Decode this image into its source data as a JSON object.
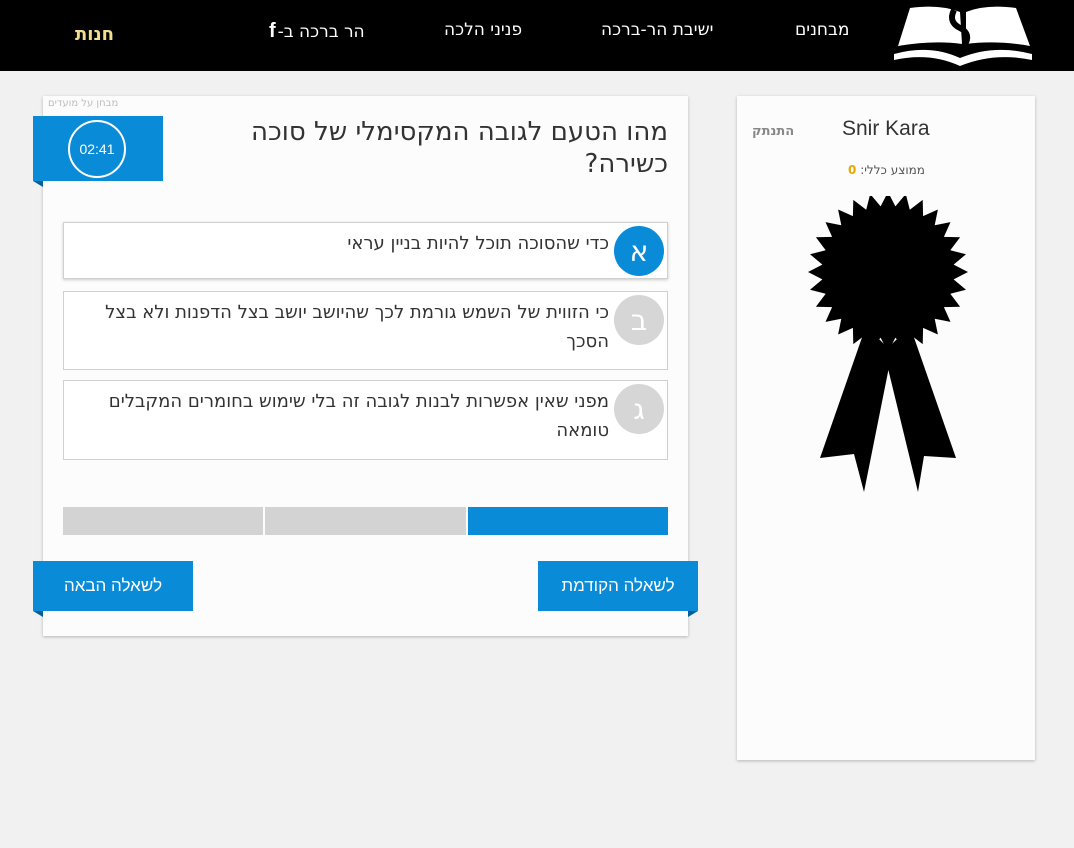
{
  "header": {
    "nav": {
      "exams": "מבחנים",
      "yeshiva": "ישיבת הר-ברכה",
      "halacha": "פניני הלכה",
      "facebook": "הר ברכה ב-",
      "store": "חנות"
    }
  },
  "quiz": {
    "exam_note": "מבחן על מועדים",
    "timer": "02:41",
    "question": "מהו הטעם לגובה המקסימלי של סוכה כשירה?",
    "answers": [
      {
        "letter": "א",
        "text": "כדי שהסוכה תוכל להיות בניין עראי",
        "selected": true
      },
      {
        "letter": "ב",
        "text": "כי הזווית של השמש גורמת לכך שהיושב יושב בצל הדפנות ולא בצל הסכך",
        "selected": false
      },
      {
        "letter": "ג",
        "text": "מפני שאין אפשרות לבנות לגובה זה בלי שימוש בחומרים המקבלים טומאה",
        "selected": false
      }
    ],
    "progress": {
      "current": 1,
      "total": 3
    },
    "buttons": {
      "next": "לשאלה הבאה",
      "prev": "לשאלה הקודמת"
    }
  },
  "user": {
    "name": "Snir Kara",
    "logout": "התנתק",
    "avg_label": "ממוצע כללי:",
    "avg_value": "0",
    "badge_icon": "award-ribbon-icon"
  },
  "colors": {
    "accent": "#0a8bd8",
    "store": "#f2de8e",
    "score": "#e6a700"
  }
}
